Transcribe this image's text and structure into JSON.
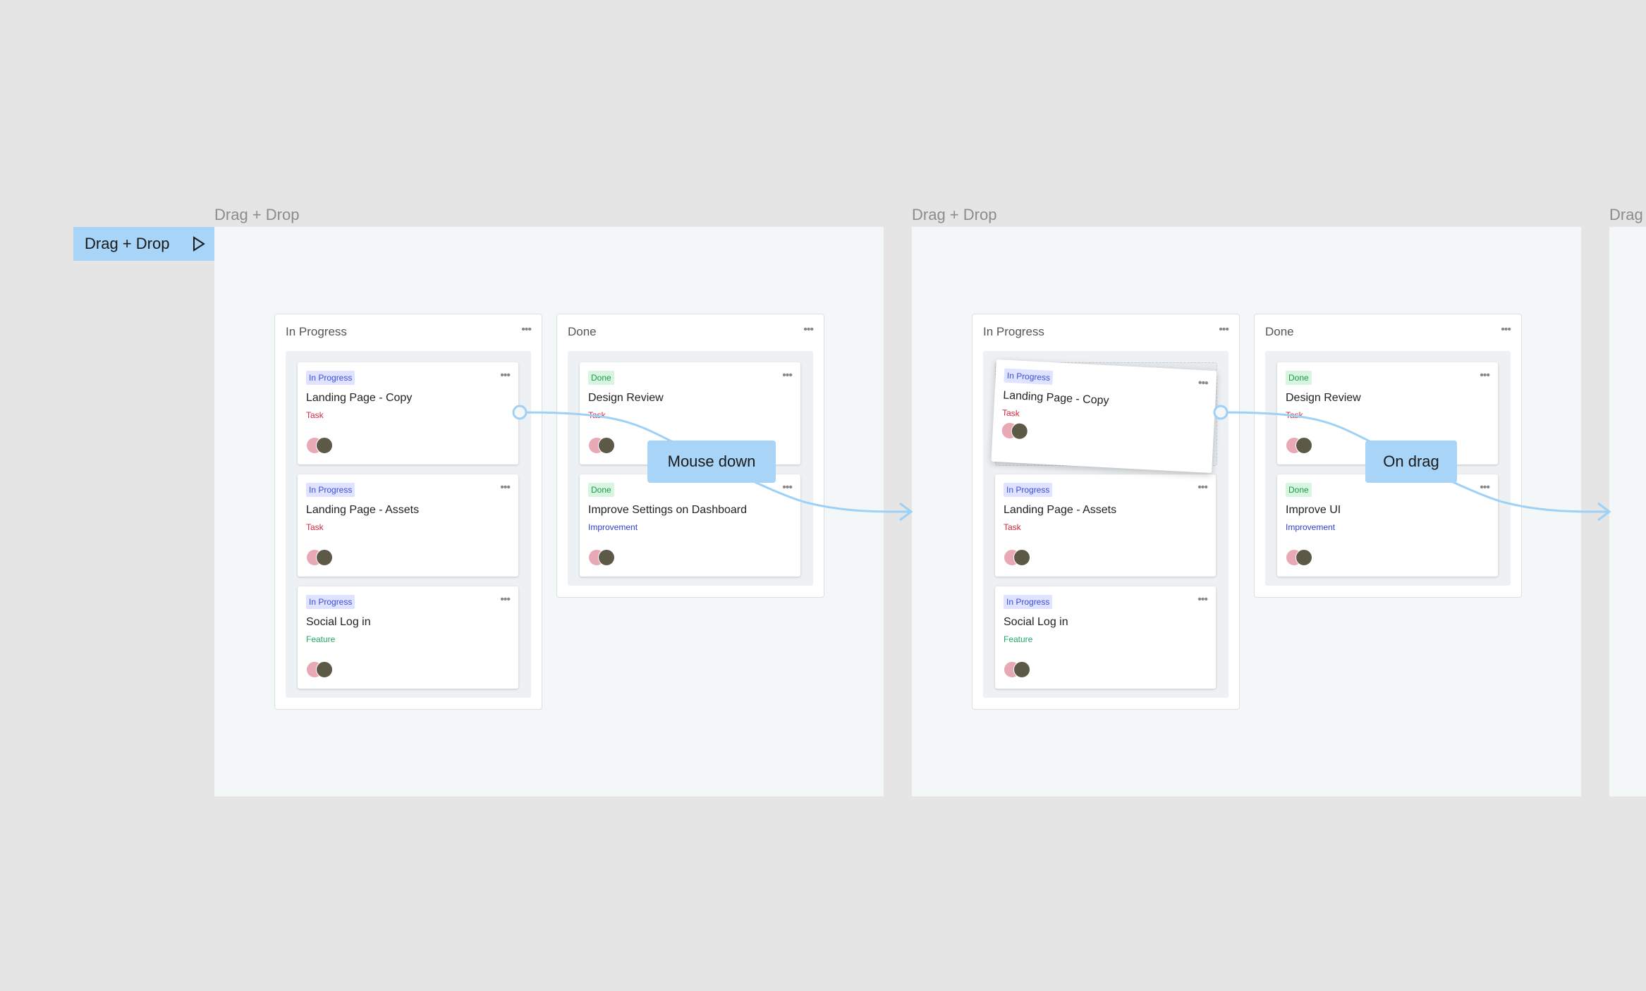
{
  "flow": {
    "label": "Drag + Drop"
  },
  "frames": [
    {
      "label": "Drag + Drop"
    },
    {
      "label": "Drag + Drop"
    },
    {
      "label": "Drag"
    }
  ],
  "frame1": {
    "in_progress": {
      "title": "In Progress",
      "cards": [
        {
          "tag": "In Progress",
          "title": "Landing Page - Copy",
          "type": "Task"
        },
        {
          "tag": "In Progress",
          "title": "Landing Page - Assets",
          "type": "Task"
        },
        {
          "tag": "In Progress",
          "title": "Social Log in",
          "type": "Feature"
        }
      ]
    },
    "done": {
      "title": "Done",
      "cards": [
        {
          "tag": "Done",
          "title": "Design Review",
          "type": "Task"
        },
        {
          "tag": "Done",
          "title": "Improve Settings on Dashboard",
          "type": "Improvement"
        }
      ]
    },
    "callout": "Mouse down"
  },
  "frame2": {
    "in_progress": {
      "title": "In Progress",
      "cards": [
        {
          "tag": "In Progress",
          "title": "Landing Page - Copy",
          "type": "Task"
        },
        {
          "tag": "In Progress",
          "title": "Landing Page - Assets",
          "type": "Task"
        },
        {
          "tag": "In Progress",
          "title": "Social Log in",
          "type": "Feature"
        }
      ]
    },
    "done": {
      "title": "Done",
      "cards": [
        {
          "tag": "Done",
          "title": "Design Review",
          "type": "Task"
        },
        {
          "tag": "Done",
          "title": "Improve UI",
          "type": "Improvement"
        }
      ]
    },
    "callout": "On drag"
  },
  "colors": {
    "canvas": "#e5e5e5",
    "frame": "#f4f7f7",
    "callout": "#a8d4f7",
    "connector": "#9fd0f5"
  },
  "icons": [
    "play-icon",
    "more-dots-icon",
    "avatar"
  ]
}
